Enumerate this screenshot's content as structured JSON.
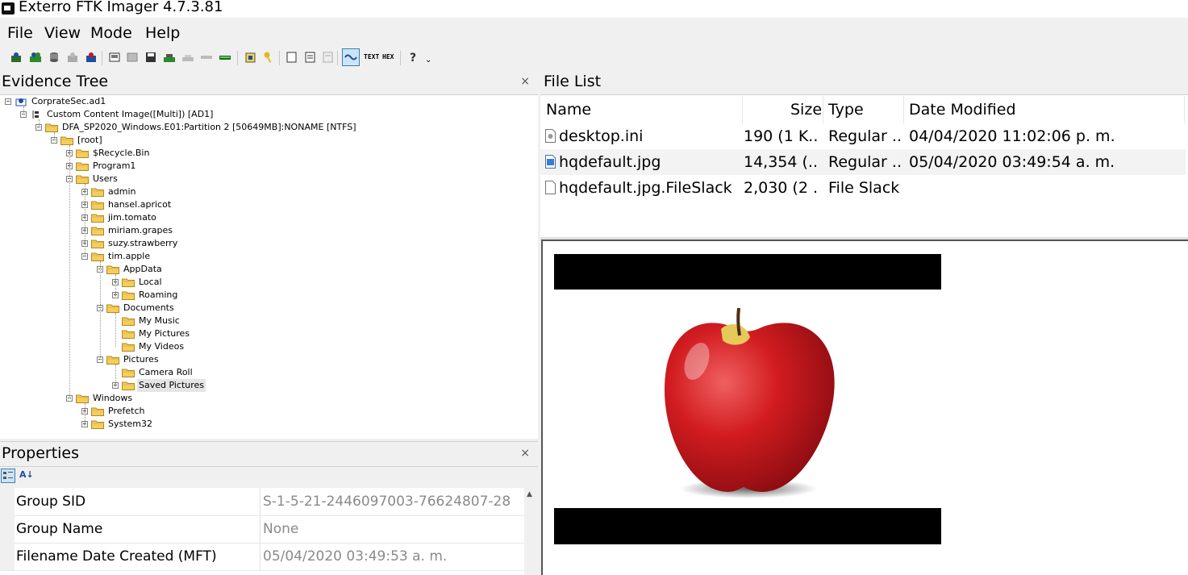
{
  "window": {
    "title": "Exterro FTK Imager 4.7.3.81"
  },
  "menu": [
    {
      "label": "File"
    },
    {
      "label": "View"
    },
    {
      "label": "Mode"
    },
    {
      "label": "Help"
    }
  ],
  "toolbar": {
    "icons": [
      "add-evidence-icon",
      "add-all-evidence-icon",
      "image-mounting-icon",
      "remove-evidence-icon",
      "remove-all-evidence-icon",
      "create-disk-image-icon",
      "export-disk-image-icon",
      "export-logical-image-icon",
      "add-to-custom-content-icon",
      "create-custom-content-image-icon",
      "decrypt-icon",
      "verify-drive-icon",
      "capture-memory-icon",
      "obtain-protected-files-icon",
      "detect-encryption-icon",
      "export-files-icon",
      "export-hash-list-icon",
      "export-directory-listing-icon",
      "auto-view-icon",
      "text-view-icon",
      "hex-view-icon",
      "help-icon"
    ],
    "text_label": "TEXT",
    "hex_label": "HEX"
  },
  "evidence_tree": {
    "title": "Evidence Tree",
    "close": "×",
    "nodes": [
      {
        "label": "CorprateSec.ad1",
        "level": 0
      },
      {
        "label": "Custom Content Image([Multi]) [AD1]",
        "level": 1
      },
      {
        "label": "DFA_SP2020_Windows.E01:Partition 2 [50649MB]:NONAME [NTFS]",
        "level": 2
      },
      {
        "label": "[root]",
        "level": 3
      },
      {
        "label": "$Recycle.Bin",
        "level": 4
      },
      {
        "label": "Program1",
        "level": 4
      },
      {
        "label": "Users",
        "level": 4
      },
      {
        "label": "admin",
        "level": 5
      },
      {
        "label": "hansel.apricot",
        "level": 5
      },
      {
        "label": "jim.tomato",
        "level": 5
      },
      {
        "label": "miriam.grapes",
        "level": 5
      },
      {
        "label": "suzy.strawberry",
        "level": 5
      },
      {
        "label": "tim.apple",
        "level": 5
      },
      {
        "label": "AppData",
        "level": 6
      },
      {
        "label": "Local",
        "level": 7
      },
      {
        "label": "Roaming",
        "level": 7
      },
      {
        "label": "Documents",
        "level": 6
      },
      {
        "label": "My Music",
        "level": 7
      },
      {
        "label": "My Pictures",
        "level": 7
      },
      {
        "label": "My Videos",
        "level": 7
      },
      {
        "label": "Pictures",
        "level": 6
      },
      {
        "label": "Camera Roll",
        "level": 7
      },
      {
        "label": "Saved Pictures",
        "level": 7
      },
      {
        "label": "Windows",
        "level": 4
      },
      {
        "label": "Prefetch",
        "level": 5
      },
      {
        "label": "System32",
        "level": 5
      }
    ]
  },
  "properties": {
    "title": "Properties",
    "close": "×",
    "rows": [
      {
        "key": "Group SID",
        "value": "S-1-5-21-2446097003-76624807-28"
      },
      {
        "key": "Group Name",
        "value": "None"
      },
      {
        "key": "Filename Date Created (MFT)",
        "value": "05/04/2020 03:49:53 a. m."
      }
    ]
  },
  "file_list": {
    "title": "File List",
    "columns": [
      "Name",
      "Size",
      "Type",
      "Date Modified"
    ],
    "rows": [
      {
        "name": "desktop.ini",
        "size": "190 (1 K...",
        "type": "Regular ...",
        "modified": "04/04/2020 11:02:06 p. m."
      },
      {
        "name": "hqdefault.jpg",
        "size": "14,354 (...",
        "type": "Regular ...",
        "modified": "05/04/2020 03:49:54 a. m."
      },
      {
        "name": "hqdefault.jpg.FileSlack",
        "size": "2,030 (2 ...",
        "type": "File Slack",
        "modified": ""
      }
    ]
  },
  "colors": {
    "selection": "#cce4f7",
    "folder": "#f5cd5d",
    "apple_red": "#c8161d"
  }
}
